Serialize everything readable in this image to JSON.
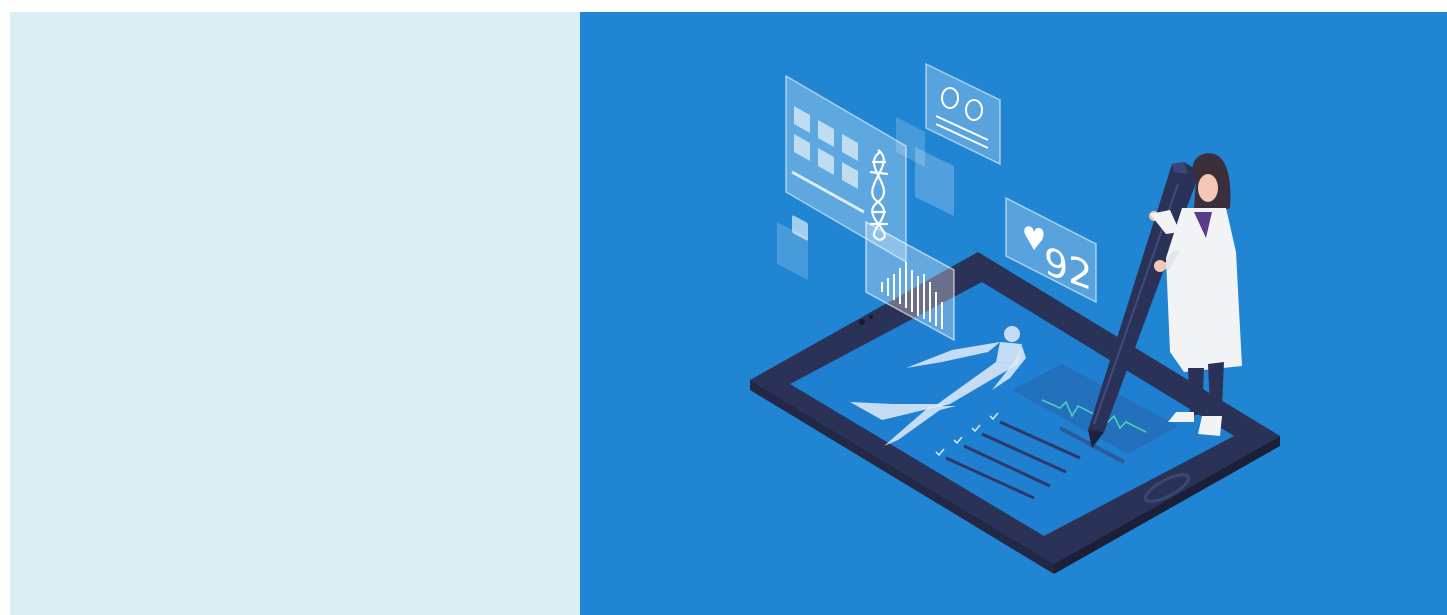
{
  "colors": {
    "left_panel_bg": "#dcedf4",
    "right_panel_bg": "#2085d3",
    "tablet_frame": "#2b3257",
    "tablet_screen": "#1f7fd0",
    "doctor_coat": "#f1f3f5",
    "doctor_hair": "#3a2f3a",
    "skin": "#f5c8b5",
    "pen": "#2b3257"
  },
  "icons": [
    "dna-icon",
    "heart-icon",
    "eyes-icon",
    "bar-chart-icon",
    "human-body-icon",
    "checklist-icon",
    "ecg-icon"
  ],
  "vitals": {
    "heart_rate": "92"
  }
}
